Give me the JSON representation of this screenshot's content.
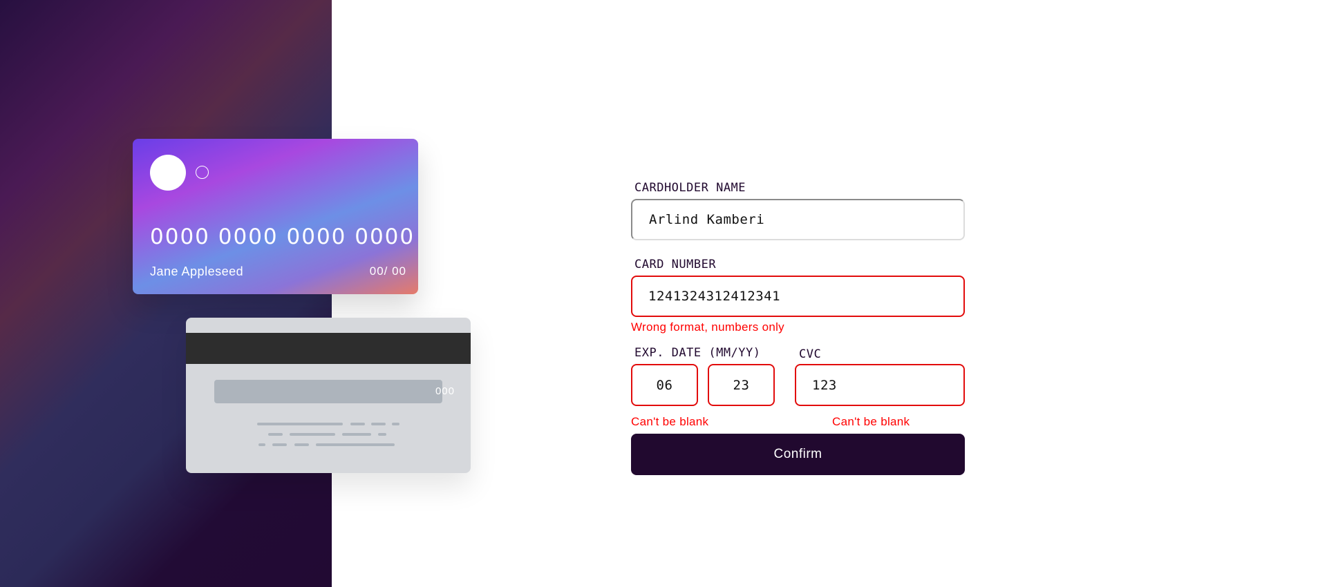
{
  "card_front": {
    "number": "0000 0000 0000 0000",
    "name": "Jane Appleseed",
    "expiry": "00/ 00"
  },
  "card_back": {
    "cvc": "000"
  },
  "form": {
    "cardholder": {
      "label": "CARDHOLDER NAME",
      "value": "Arlind Kamberi"
    },
    "card_number": {
      "label": "CARD NUMBER",
      "value": "1241324312412341",
      "error": "Wrong format, numbers only"
    },
    "exp_date": {
      "label": "EXP. DATE (MM/YY)",
      "month": "06",
      "year": "23",
      "error": "Can't be blank"
    },
    "cvc": {
      "label": "CVC",
      "value": "123",
      "error": "Can't be blank"
    },
    "confirm_label": "Confirm"
  },
  "colors": {
    "error": "#ff0000",
    "button": "#21092f",
    "input_error_border": "#e20b0b"
  }
}
